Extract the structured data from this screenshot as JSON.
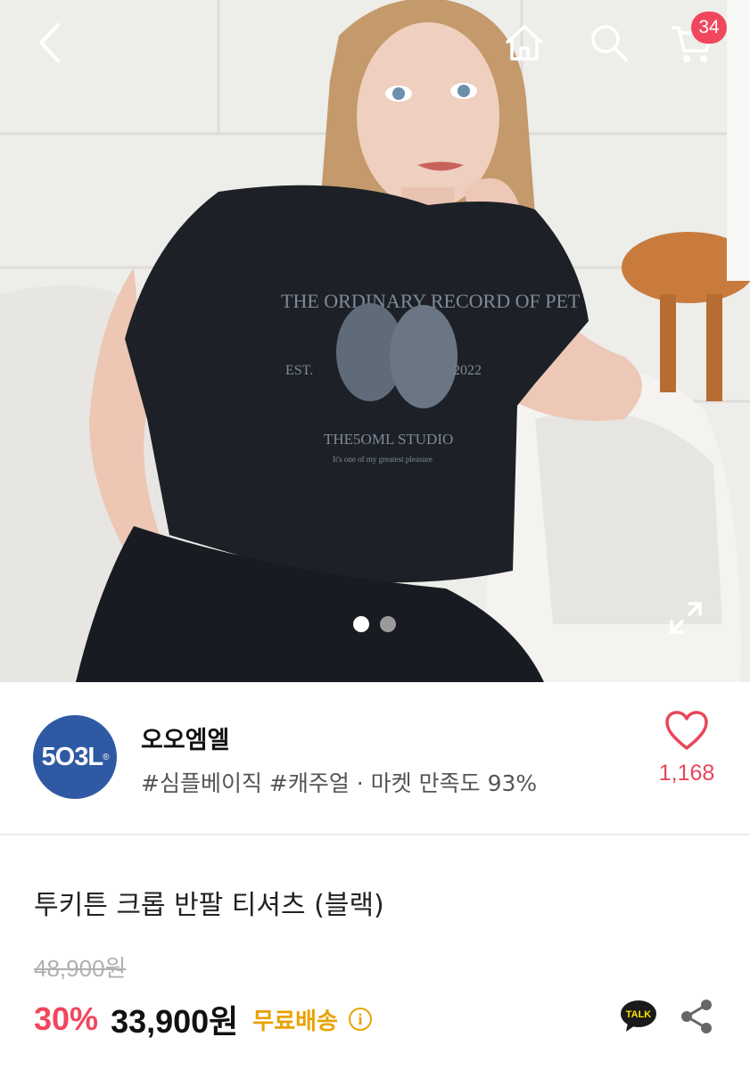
{
  "topbar": {
    "cart_count": "34"
  },
  "icons": {
    "back": "back-arrow-icon",
    "home": "home-icon",
    "search": "search-icon",
    "cart": "cart-icon",
    "expand": "expand-icon",
    "heart": "heart-icon",
    "talk": "kakaotalk-icon",
    "share": "share-icon",
    "info": "info-icon"
  },
  "hero": {
    "carousel_total": 2,
    "carousel_active": 1,
    "tshirt_print": {
      "line1": "THE ORDINARY RECORD OF PET",
      "est": "EST.",
      "year": "2022",
      "studio": "THE5OML STUDIO",
      "tagline": "It's one of my greatest pleasure"
    }
  },
  "shop": {
    "logo_text": "5O3L",
    "logo_mark": "®",
    "name": "오오엠엘",
    "tags": "#심플베이직 #캐주얼 · 마켓 만족도 93%",
    "like_count": "1,168"
  },
  "product": {
    "title": "투키튼 크롭 반팔 티셔츠 (블랙)",
    "original_price": "48,900원",
    "discount": "30%",
    "price": "33,900원",
    "shipping": "무료배송",
    "info_symbol": "i",
    "talk_label": "TALK"
  },
  "colors": {
    "accent": "#f0475d",
    "shipping": "#e8a300",
    "logo_bg": "#2f5aa3"
  }
}
